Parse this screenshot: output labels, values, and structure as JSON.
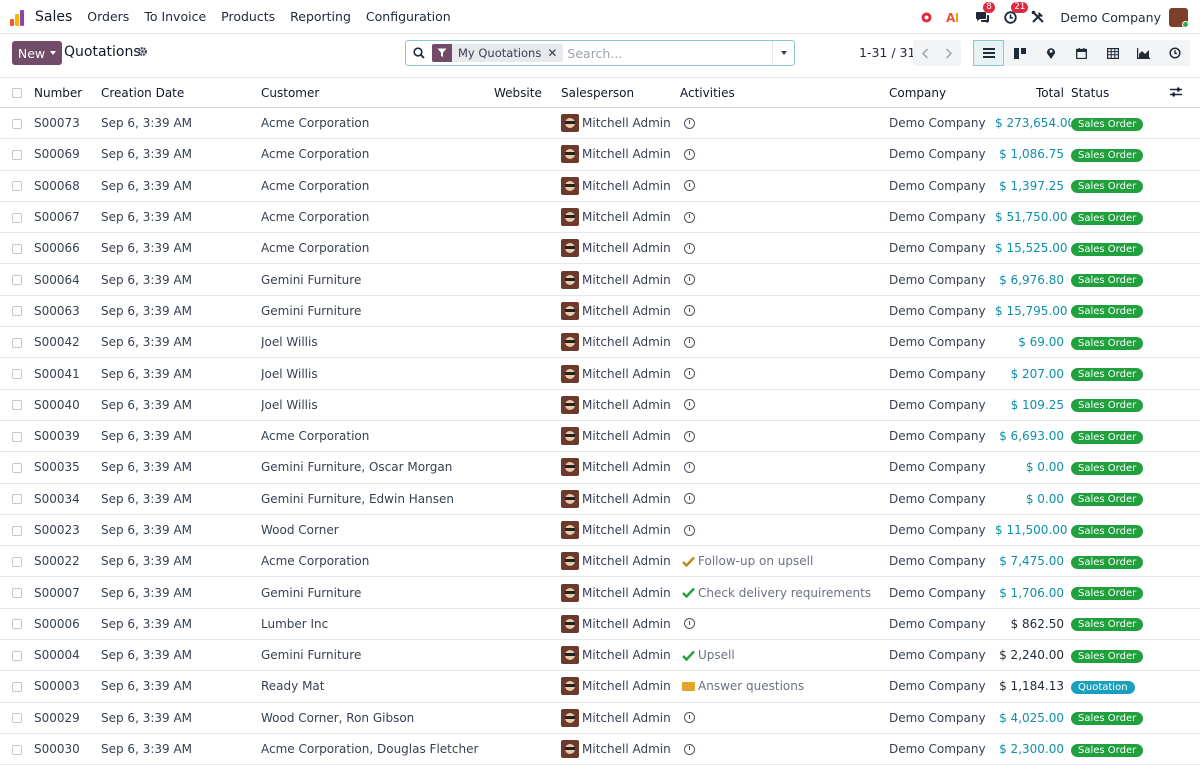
{
  "navbar": {
    "app_name": "Sales",
    "menu": [
      "Orders",
      "To Invoice",
      "Products",
      "Reporting",
      "Configuration"
    ],
    "messages_badge": "8",
    "activities_badge": "21",
    "company": "Demo Company",
    "logo_colors": [
      "#f05a28",
      "#ffb400",
      "#8e44ad",
      "#2b7bb9"
    ]
  },
  "control": {
    "new_label": "New",
    "title": "Quotations",
    "facet_label": "My Quotations",
    "search_placeholder": "Search...",
    "pager": "1-31 / 31"
  },
  "columns": {
    "number": "Number",
    "creation_date": "Creation Date",
    "customer": "Customer",
    "website": "Website",
    "salesperson": "Salesperson",
    "activities": "Activities",
    "company": "Company",
    "total": "Total",
    "status": "Status"
  },
  "rows": [
    {
      "number": "S00073",
      "date": "Sep 6, 3:39 AM",
      "customer": "Acme Corporation",
      "salesperson": "Mitchell Admin",
      "activity": "",
      "activity_type": "clock",
      "company": "Demo Company",
      "total": "$ 273,654.00",
      "total_style": "link",
      "status": "Sales Order"
    },
    {
      "number": "S00069",
      "date": "Sep 6, 3:39 AM",
      "customer": "Acme Corporation",
      "salesperson": "Mitchell Admin",
      "activity": "",
      "activity_type": "clock",
      "company": "Demo Company",
      "total": "$ 1,086.75",
      "total_style": "link",
      "status": "Sales Order"
    },
    {
      "number": "S00068",
      "date": "Sep 6, 3:39 AM",
      "customer": "Acme Corporation",
      "salesperson": "Mitchell Admin",
      "activity": "",
      "activity_type": "clock",
      "company": "Demo Company",
      "total": "$ 1,397.25",
      "total_style": "link",
      "status": "Sales Order"
    },
    {
      "number": "S00067",
      "date": "Sep 6, 3:39 AM",
      "customer": "Acme Corporation",
      "salesperson": "Mitchell Admin",
      "activity": "",
      "activity_type": "clock",
      "company": "Demo Company",
      "total": "$ 51,750.00",
      "total_style": "link",
      "status": "Sales Order"
    },
    {
      "number": "S00066",
      "date": "Sep 6, 3:39 AM",
      "customer": "Acme Corporation",
      "salesperson": "Mitchell Admin",
      "activity": "",
      "activity_type": "clock",
      "company": "Demo Company",
      "total": "$ 15,525.00",
      "total_style": "link",
      "status": "Sales Order"
    },
    {
      "number": "S00064",
      "date": "Sep 6, 3:39 AM",
      "customer": "Gemini Furniture",
      "salesperson": "Mitchell Admin",
      "activity": "",
      "activity_type": "clock",
      "company": "Demo Company",
      "total": "$ 6,976.80",
      "total_style": "link",
      "status": "Sales Order"
    },
    {
      "number": "S00063",
      "date": "Sep 6, 3:39 AM",
      "customer": "Gemini Furniture",
      "salesperson": "Mitchell Admin",
      "activity": "",
      "activity_type": "clock",
      "company": "Demo Company",
      "total": "$ 15,795.00",
      "total_style": "link",
      "status": "Sales Order"
    },
    {
      "number": "S00042",
      "date": "Sep 6, 3:39 AM",
      "customer": "Joel Willis",
      "salesperson": "Mitchell Admin",
      "activity": "",
      "activity_type": "clock",
      "company": "Demo Company",
      "total": "$ 69.00",
      "total_style": "link",
      "status": "Sales Order"
    },
    {
      "number": "S00041",
      "date": "Sep 6, 3:39 AM",
      "customer": "Joel Willis",
      "salesperson": "Mitchell Admin",
      "activity": "",
      "activity_type": "clock",
      "company": "Demo Company",
      "total": "$ 207.00",
      "total_style": "link",
      "status": "Sales Order"
    },
    {
      "number": "S00040",
      "date": "Sep 6, 3:39 AM",
      "customer": "Joel Willis",
      "salesperson": "Mitchell Admin",
      "activity": "",
      "activity_type": "clock",
      "company": "Demo Company",
      "total": "$ 109.25",
      "total_style": "link",
      "status": "Sales Order"
    },
    {
      "number": "S00039",
      "date": "Sep 6, 3:39 AM",
      "customer": "Acme Corporation",
      "salesperson": "Mitchell Admin",
      "activity": "",
      "activity_type": "clock",
      "company": "Demo Company",
      "total": "$ 6,693.00",
      "total_style": "link",
      "status": "Sales Order"
    },
    {
      "number": "S00035",
      "date": "Sep 6, 3:39 AM",
      "customer": "Gemini Furniture, Oscar Morgan",
      "salesperson": "Mitchell Admin",
      "activity": "",
      "activity_type": "clock",
      "company": "Demo Company",
      "total": "$ 0.00",
      "total_style": "link",
      "status": "Sales Order"
    },
    {
      "number": "S00034",
      "date": "Sep 6, 3:39 AM",
      "customer": "Gemini Furniture, Edwin Hansen",
      "salesperson": "Mitchell Admin",
      "activity": "",
      "activity_type": "clock",
      "company": "Demo Company",
      "total": "$ 0.00",
      "total_style": "link",
      "status": "Sales Order"
    },
    {
      "number": "S00023",
      "date": "Sep 6, 3:39 AM",
      "customer": "Wood Corner",
      "salesperson": "Mitchell Admin",
      "activity": "",
      "activity_type": "clock",
      "company": "Demo Company",
      "total": "$ 11,500.00",
      "total_style": "link",
      "status": "Sales Order"
    },
    {
      "number": "S00022",
      "date": "Sep 6, 3:39 AM",
      "customer": "Acme Corporation",
      "salesperson": "Mitchell Admin",
      "activity": "Follow-up on upsell",
      "activity_type": "check-amber",
      "company": "Demo Company",
      "total": "$ 7,475.00",
      "total_style": "link",
      "status": "Sales Order"
    },
    {
      "number": "S00007",
      "date": "Sep 6, 3:39 AM",
      "customer": "Gemini Furniture",
      "salesperson": "Mitchell Admin",
      "activity": "Check delivery requirements",
      "activity_type": "check-green",
      "company": "Demo Company",
      "total": "$ 1,706.00",
      "total_style": "link",
      "status": "Sales Order"
    },
    {
      "number": "S00006",
      "date": "Sep 6, 3:39 AM",
      "customer": "Lumber Inc",
      "salesperson": "Mitchell Admin",
      "activity": "",
      "activity_type": "clock",
      "company": "Demo Company",
      "total": "$ 862.50",
      "total_style": "plain",
      "status": "Sales Order"
    },
    {
      "number": "S00004",
      "date": "Sep 6, 3:39 AM",
      "customer": "Gemini Furniture",
      "salesperson": "Mitchell Admin",
      "activity": "Upsell",
      "activity_type": "check-green",
      "company": "Demo Company",
      "total": "$ 2,240.00",
      "total_style": "plain",
      "status": "Sales Order"
    },
    {
      "number": "S00003",
      "date": "Sep 6, 3:39 AM",
      "customer": "Ready Mat",
      "salesperson": "Mitchell Admin",
      "activity": "Answer questions",
      "activity_type": "envelope",
      "company": "Demo Company",
      "total": "$ 1,184.13",
      "total_style": "plain",
      "status": "Quotation"
    },
    {
      "number": "S00029",
      "date": "Sep 6, 3:39 AM",
      "customer": "Wood Corner, Ron Gibson",
      "salesperson": "Mitchell Admin",
      "activity": "",
      "activity_type": "clock",
      "company": "Demo Company",
      "total": "$ 4,025.00",
      "total_style": "link",
      "status": "Sales Order"
    },
    {
      "number": "S00030",
      "date": "Sep 6, 3:39 AM",
      "customer": "Acme Corporation, Douglas Fletcher",
      "salesperson": "Mitchell Admin",
      "activity": "",
      "activity_type": "clock",
      "company": "Demo Company",
      "total": "$ 2,300.00",
      "total_style": "link",
      "status": "Sales Order"
    }
  ]
}
